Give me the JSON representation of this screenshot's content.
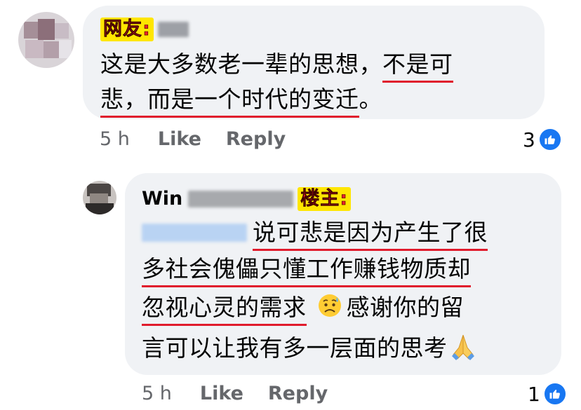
{
  "comment1": {
    "tag": "网友:",
    "lines": [
      "这是大多数老一辈的思想，",
      "不是可",
      "悲，而是一个时代的变迁",
      "。"
    ],
    "time": "5 h",
    "like_label": "Like",
    "reply_label": "Reply",
    "reaction_count": "3"
  },
  "comment2": {
    "author_first": "Win",
    "tag": "楼主:",
    "line1": "说可悲是因为产生了很",
    "line2": "多社会傀儡只懂工作赚钱物质却",
    "line3a": "忽视心灵的需求",
    "line3b": "感谢你的留",
    "line4": "言可以让我有多一层面的思考",
    "time": "5 h",
    "like_label": "Like",
    "reply_label": "Reply",
    "reaction_count": "1"
  },
  "icons": {
    "reaction": "like-thumb-icon",
    "emoji_sad": "sad-sweat-face-icon",
    "emoji_pray": "folded-hands-icon"
  },
  "colors": {
    "bubble": "#f0f2f5",
    "underline": "#e01b2c",
    "tag_bg": "#ffe600",
    "tag_text": "#e8212a",
    "like_blue": "#1877f2",
    "meta_text": "#65676b"
  }
}
